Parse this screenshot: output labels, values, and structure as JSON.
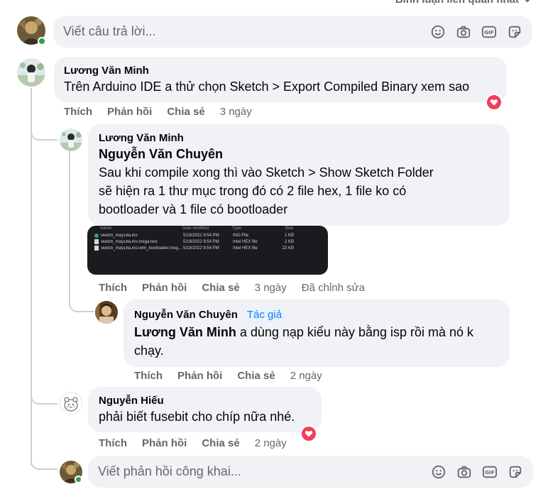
{
  "sort": {
    "label": "Bình luận liên quan nhất"
  },
  "top_composer": {
    "placeholder": "Viết câu trả lời..."
  },
  "bottom_composer": {
    "placeholder": "Viết phản hồi công khai..."
  },
  "actions": {
    "like": "Thích",
    "reply": "Phản hồi",
    "share": "Chia sẻ"
  },
  "comments": [
    {
      "author": "Lương Văn Minh",
      "text": "Trên Arduino IDE a thử chọn Sketch > Export Compiled Binary xem sao",
      "time": "3 ngày",
      "reaction": "heart"
    },
    {
      "author": "Lương Văn Minh",
      "mention": "Nguyễn Văn Chuyên",
      "lines": [
        "Sau khi compile xong thì vào Sketch > Show Sketch Folder",
        "sẽ hiện ra 1 thư mục trong đó có 2 file hex, 1 file ko có",
        "bootloader và 1 file có bootloader"
      ],
      "time": "3 ngày",
      "edited": "Đã chỉnh sửa",
      "attachment": {
        "headers": [
          "Name",
          "Date modified",
          "Type",
          "Size"
        ],
        "rows": [
          [
            "sketch_may18a.ino",
            "5/18/2022 9:54 PM",
            "INO File",
            "1 KB"
          ],
          [
            "sketch_may18a.ino.mega.hex",
            "5/18/2022 9:54 PM",
            "Intel HEX file",
            "2 KB"
          ],
          [
            "sketch_may18a.ino.with_bootloader.meg...",
            "5/18/2022 9:54 PM",
            "Intel HEX file",
            "22 KB"
          ]
        ]
      }
    },
    {
      "author": "Nguyễn Văn Chuyên",
      "badge": "Tác giả",
      "mention": "Lương Văn Minh",
      "line1_rest": " a dùng nạp kiểu này bằng isp rồi mà nó k",
      "line2": "chạy.",
      "time": "2 ngày"
    },
    {
      "author": "Nguyễn Hiếu",
      "text": "phải biết fusebit cho chíp nữa nhé.",
      "time": "2 ngày",
      "reaction": "heart"
    }
  ],
  "colors": {
    "online": "#31a24c",
    "heart": "#f33e58",
    "bubble": "#f0f2f5",
    "muted": "#65676b",
    "badge_bg": "#e7f3ff",
    "badge_text": "#1877f2"
  }
}
